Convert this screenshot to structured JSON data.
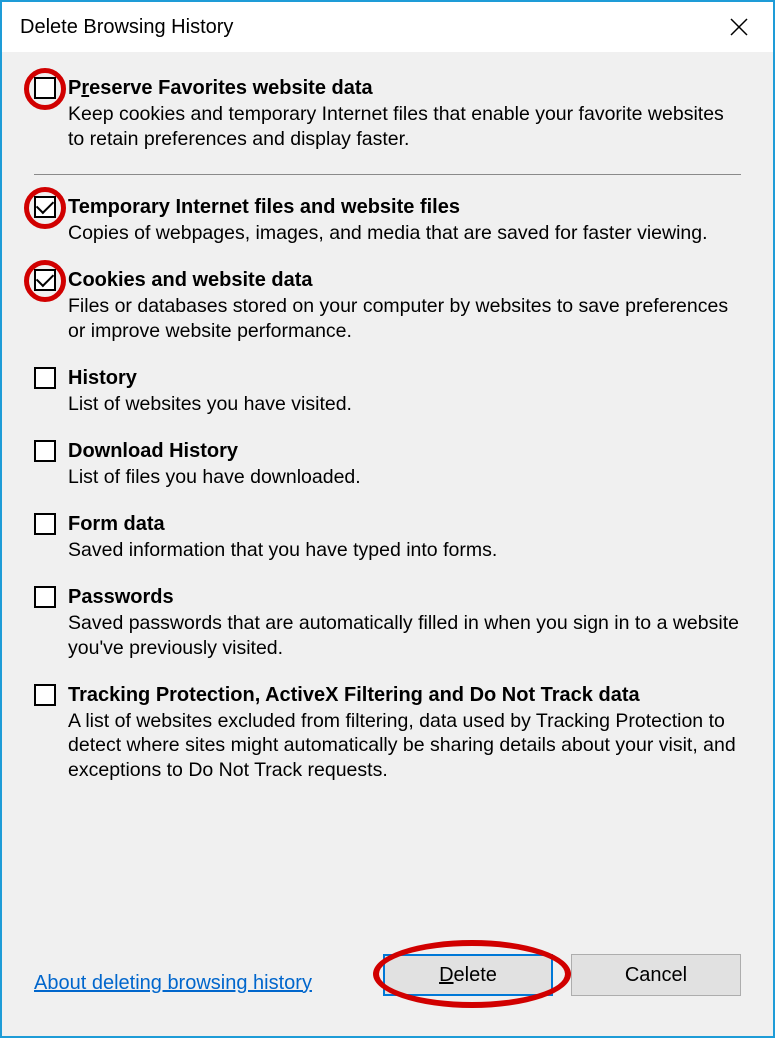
{
  "window": {
    "title": "Delete Browsing History"
  },
  "options": {
    "preserve": {
      "label_pre": "P",
      "label_u": "r",
      "label_post": "eserve Favorites website data",
      "desc": "Keep cookies and temporary Internet files that enable your favorite websites to retain preferences and display faster.",
      "checked": false,
      "circled": true
    },
    "temp": {
      "label": "Temporary Internet files and website files",
      "desc": "Copies of webpages, images, and media that are saved for faster viewing.",
      "checked": true,
      "circled": true
    },
    "cookies": {
      "label": "Cookies and website data",
      "desc": "Files or databases stored on your computer by websites to save preferences or improve website performance.",
      "checked": true,
      "circled": true
    },
    "history": {
      "label": "History",
      "desc": "List of websites you have visited.",
      "checked": false,
      "circled": false
    },
    "download": {
      "label": "Download History",
      "desc": "List of files you have downloaded.",
      "checked": false,
      "circled": false
    },
    "form": {
      "label": "Form data",
      "desc": "Saved information that you have typed into forms.",
      "checked": false,
      "circled": false
    },
    "passwords": {
      "label": "Passwords",
      "desc": "Saved passwords that are automatically filled in when you sign in to a website you've previously visited.",
      "checked": false,
      "circled": false
    },
    "tracking": {
      "label": "Tracking Protection, ActiveX Filtering and Do Not Track data",
      "desc": "A list of websites excluded from filtering, data used by Tracking Protection to detect where sites might automatically be sharing details about your visit, and exceptions to Do Not Track requests.",
      "checked": false,
      "circled": false
    }
  },
  "footer": {
    "help_link": "About deleting browsing history",
    "delete_u": "D",
    "delete_post": "elete",
    "cancel": "Cancel"
  }
}
